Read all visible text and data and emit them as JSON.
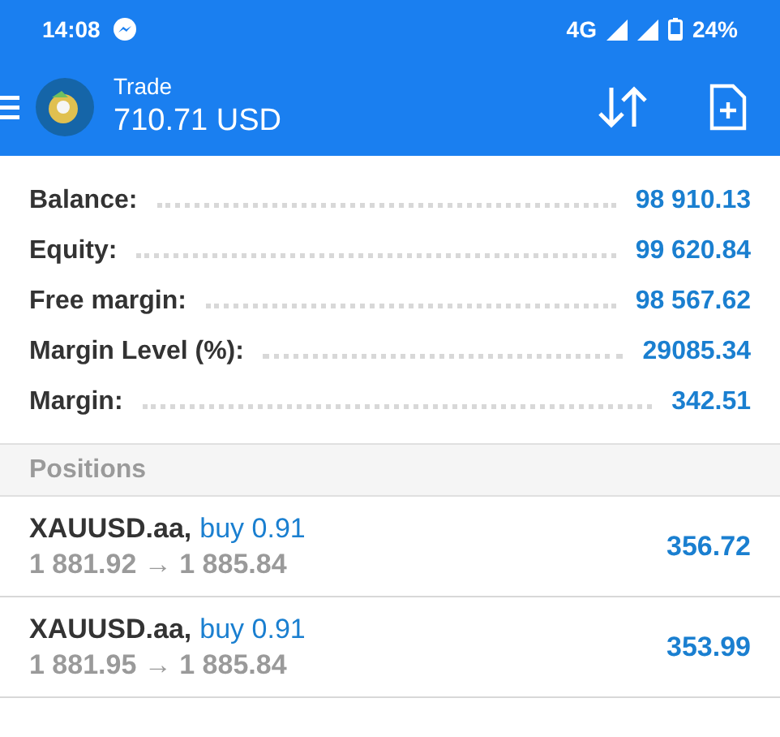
{
  "status_bar": {
    "time": "14:08",
    "network": "4G",
    "battery": "24%"
  },
  "header": {
    "title": "Trade",
    "balance": "710.71 USD"
  },
  "summary": [
    {
      "label": "Balance:",
      "value": "98 910.13"
    },
    {
      "label": "Equity:",
      "value": "99 620.84"
    },
    {
      "label": "Free margin:",
      "value": "98 567.62"
    },
    {
      "label": "Margin Level (%):",
      "value": "29085.34"
    },
    {
      "label": "Margin:",
      "value": "342.51"
    }
  ],
  "positions_header": "Positions",
  "positions": [
    {
      "symbol": "XAUUSD.aa,",
      "order": "buy 0.91",
      "prices": "1 881.92 → 1 885.84",
      "profit": "356.72"
    },
    {
      "symbol": "XAUUSD.aa,",
      "order": "buy 0.91",
      "prices": "1 881.95 → 1 885.84",
      "profit": "353.99"
    }
  ]
}
